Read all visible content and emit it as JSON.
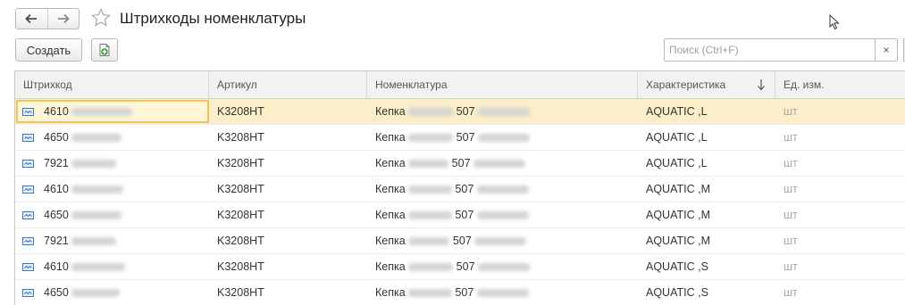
{
  "window": {
    "title": "Штрихкоды номенклатуры",
    "back_icon": "arrow-left-icon",
    "forward_icon": "arrow-right-icon",
    "favorite_icon": "star-icon"
  },
  "toolbar": {
    "create_label": "Создать",
    "add_icon": "document-add-icon"
  },
  "search": {
    "placeholder": "Поиск (Ctrl+F)",
    "value": "",
    "clear_label": "×"
  },
  "table": {
    "columns": [
      "Штрихкод",
      "Артикул",
      "Номенклатура",
      "Характеристика",
      "Ед. изм."
    ],
    "sorted_column": "Характеристика",
    "sort_direction": "descending",
    "rows": [
      {
        "barcode": "4610",
        "article": "K3208HT",
        "nomenclature_prefix": "Кепка",
        "nomenclature_mid": "507",
        "characteristic": "AQUATIC ,L",
        "unit": "шт",
        "selected": true
      },
      {
        "barcode": "4650",
        "article": "K3208HT",
        "nomenclature_prefix": "Кепка",
        "nomenclature_mid": "507",
        "characteristic": "AQUATIC ,L",
        "unit": "шт"
      },
      {
        "barcode": "7921",
        "article": "K3208HT",
        "nomenclature_prefix": "Кепка",
        "nomenclature_mid": "507",
        "characteristic": "AQUATIC ,L",
        "unit": "шт"
      },
      {
        "barcode": "4610",
        "article": "K3208HT",
        "nomenclature_prefix": "Кепка",
        "nomenclature_mid": "507",
        "characteristic": "AQUATIC ,M",
        "unit": "шт"
      },
      {
        "barcode": "4650",
        "article": "K3208HT",
        "nomenclature_prefix": "Кепка",
        "nomenclature_mid": "507",
        "characteristic": "AQUATIC ,M",
        "unit": "шт"
      },
      {
        "barcode": "7921",
        "article": "K3208HT",
        "nomenclature_prefix": "Кепка",
        "nomenclature_mid": "507",
        "characteristic": "AQUATIC ,M",
        "unit": "шт"
      },
      {
        "barcode": "4610",
        "article": "K3208HT",
        "nomenclature_prefix": "Кепка",
        "nomenclature_mid": "507",
        "characteristic": "AQUATIC ,S",
        "unit": "шт"
      },
      {
        "barcode": "4650",
        "article": "K3208HT",
        "nomenclature_prefix": "Кепка",
        "nomenclature_mid": "507",
        "characteristic": "AQUATIC ,S",
        "unit": "шт"
      }
    ]
  },
  "colors": {
    "selected_row": "#fbeec8",
    "focus_border": "#f2c35e",
    "header_bg": "#f2f2f2",
    "unit_text": "#a8a8a8"
  }
}
